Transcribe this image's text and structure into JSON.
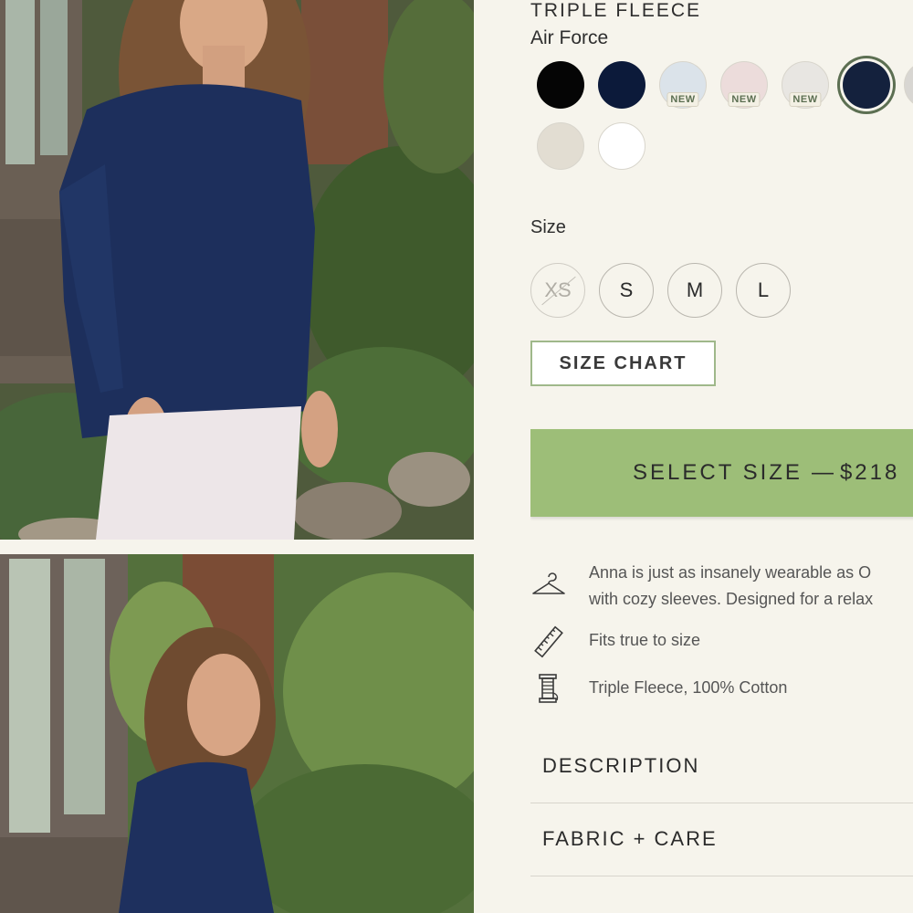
{
  "product": {
    "collection": "TRIPLE FLEECE",
    "color_name": "Air Force"
  },
  "swatches": [
    {
      "color": "#050505",
      "badge": ""
    },
    {
      "color": "#0c1a3a",
      "badge": ""
    },
    {
      "color": "#dbe3ea",
      "badge": "NEW"
    },
    {
      "color": "#ecdcdb",
      "badge": "NEW"
    },
    {
      "color": "#e8e6e2",
      "badge": "NEW"
    },
    {
      "color": "#14213d",
      "badge": "",
      "selected": true
    },
    {
      "color": "#d8d6d2",
      "badge": ""
    },
    {
      "color": "#e2ddd2",
      "badge": ""
    },
    {
      "color": "#ffffff",
      "badge": ""
    }
  ],
  "size": {
    "label": "Size",
    "options": [
      {
        "label": "XS",
        "available": false
      },
      {
        "label": "S",
        "available": true
      },
      {
        "label": "M",
        "available": true
      },
      {
        "label": "L",
        "available": true
      }
    ],
    "chart_label": "SIZE CHART"
  },
  "cta": {
    "label": "SELECT SIZE",
    "separator": "—",
    "price": "$218"
  },
  "features": [
    {
      "icon": "hanger-icon",
      "lines": [
        "Anna is just as insanely wearable as O",
        "with cozy sleeves. Designed for a relax"
      ]
    },
    {
      "icon": "ruler-icon",
      "lines": [
        "Fits true to size"
      ]
    },
    {
      "icon": "thread-spool-icon",
      "lines": [
        "Triple Fleece, 100% Cotton"
      ]
    }
  ],
  "accordions": [
    {
      "label": "DESCRIPTION"
    },
    {
      "label": "FABRIC + CARE"
    }
  ],
  "colors": {
    "background": "#f6f4ec",
    "accent_green": "#9dbe78",
    "selected_ring": "#5c6f52"
  }
}
